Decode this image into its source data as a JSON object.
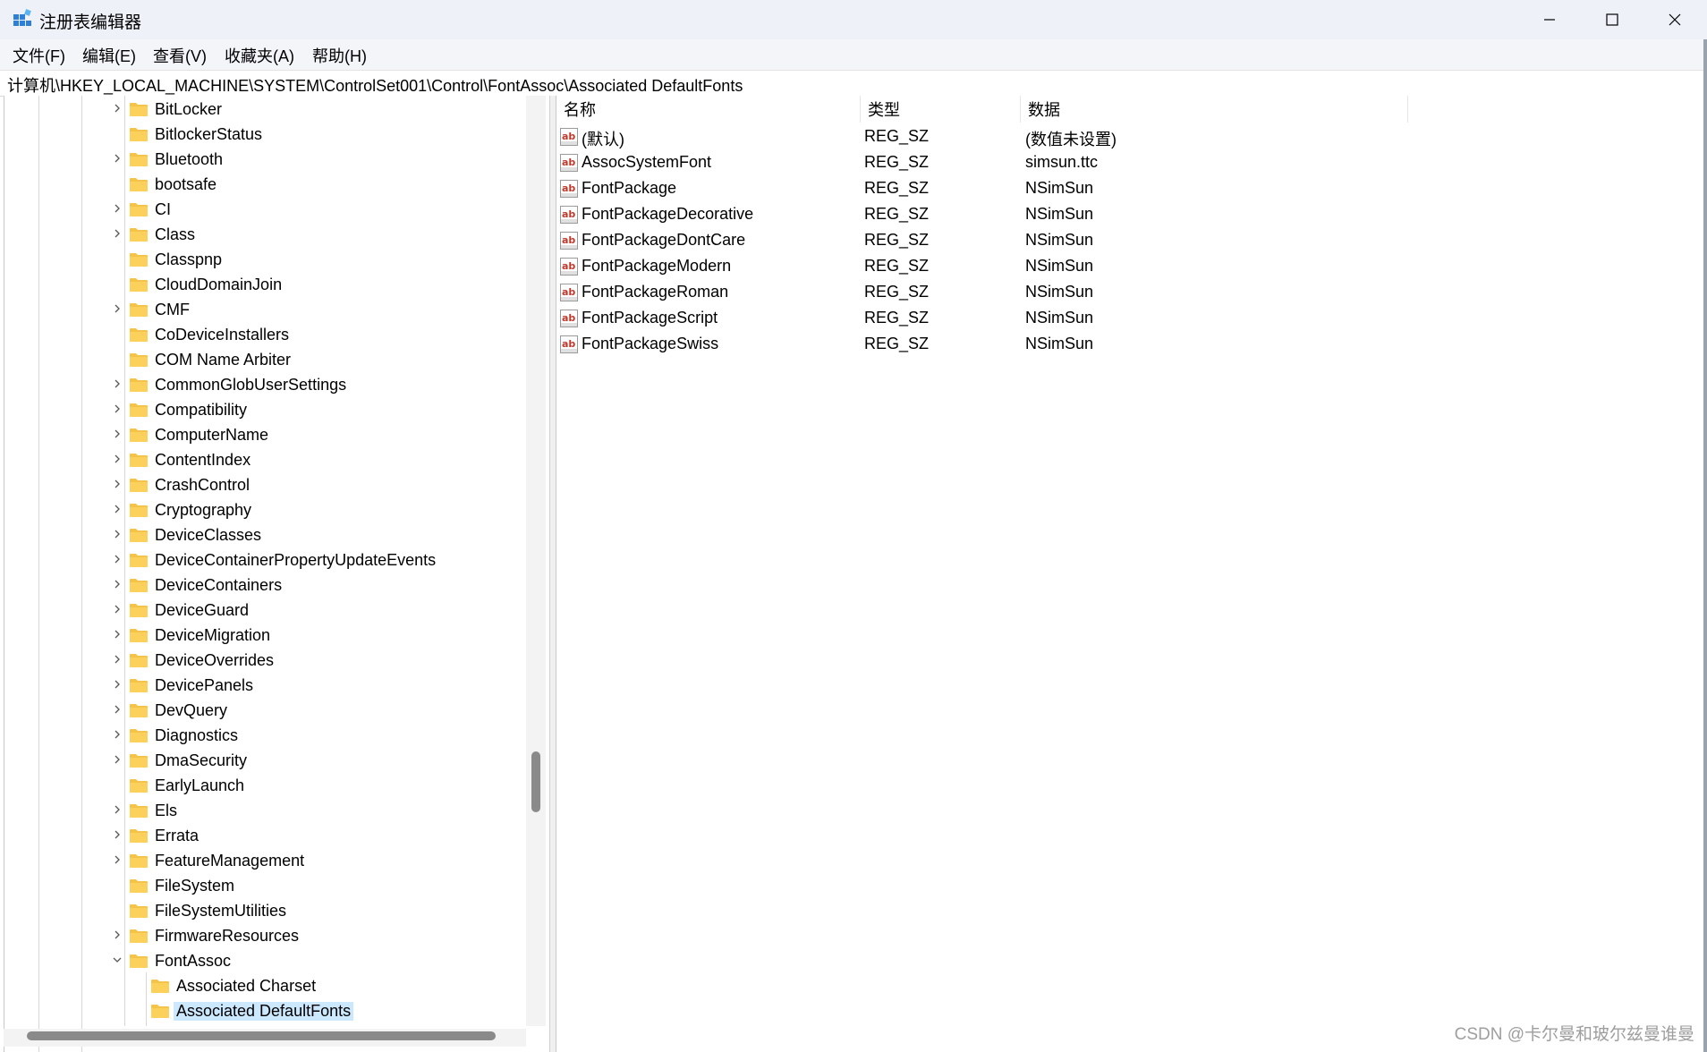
{
  "window": {
    "title": "注册表编辑器",
    "icon": "registry-editor-icon",
    "controls": [
      "minimize-icon",
      "maximize-icon",
      "close-icon"
    ]
  },
  "menu": [
    "文件(F)",
    "编辑(E)",
    "查看(V)",
    "收藏夹(A)",
    "帮助(H)"
  ],
  "address": "计算机\\HKEY_LOCAL_MACHINE\\SYSTEM\\ControlSet001\\Control\\FontAssoc\\Associated DefaultFonts",
  "tree": [
    {
      "label": "BitLocker",
      "expander": "collapsed"
    },
    {
      "label": "BitlockerStatus",
      "expander": "none"
    },
    {
      "label": "Bluetooth",
      "expander": "collapsed"
    },
    {
      "label": "bootsafe",
      "expander": "none"
    },
    {
      "label": "CI",
      "expander": "collapsed"
    },
    {
      "label": "Class",
      "expander": "collapsed"
    },
    {
      "label": "Classpnp",
      "expander": "none"
    },
    {
      "label": "CloudDomainJoin",
      "expander": "none"
    },
    {
      "label": "CMF",
      "expander": "collapsed"
    },
    {
      "label": "CoDeviceInstallers",
      "expander": "none"
    },
    {
      "label": "COM Name Arbiter",
      "expander": "none"
    },
    {
      "label": "CommonGlobUserSettings",
      "expander": "collapsed"
    },
    {
      "label": "Compatibility",
      "expander": "collapsed"
    },
    {
      "label": "ComputerName",
      "expander": "collapsed"
    },
    {
      "label": "ContentIndex",
      "expander": "collapsed"
    },
    {
      "label": "CrashControl",
      "expander": "collapsed"
    },
    {
      "label": "Cryptography",
      "expander": "collapsed"
    },
    {
      "label": "DeviceClasses",
      "expander": "collapsed"
    },
    {
      "label": "DeviceContainerPropertyUpdateEvents",
      "expander": "collapsed"
    },
    {
      "label": "DeviceContainers",
      "expander": "collapsed"
    },
    {
      "label": "DeviceGuard",
      "expander": "collapsed"
    },
    {
      "label": "DeviceMigration",
      "expander": "collapsed"
    },
    {
      "label": "DeviceOverrides",
      "expander": "collapsed"
    },
    {
      "label": "DevicePanels",
      "expander": "collapsed"
    },
    {
      "label": "DevQuery",
      "expander": "collapsed"
    },
    {
      "label": "Diagnostics",
      "expander": "collapsed"
    },
    {
      "label": "DmaSecurity",
      "expander": "collapsed"
    },
    {
      "label": "EarlyLaunch",
      "expander": "none"
    },
    {
      "label": "Els",
      "expander": "collapsed"
    },
    {
      "label": "Errata",
      "expander": "collapsed"
    },
    {
      "label": "FeatureManagement",
      "expander": "collapsed"
    },
    {
      "label": "FileSystem",
      "expander": "none"
    },
    {
      "label": "FileSystemUtilities",
      "expander": "none"
    },
    {
      "label": "FirmwareResources",
      "expander": "collapsed"
    },
    {
      "label": "FontAssoc",
      "expander": "expanded"
    },
    {
      "label": "Associated Charset",
      "expander": "none",
      "child": true
    },
    {
      "label": "Associated DefaultFonts",
      "expander": "none",
      "child": true,
      "selected": true
    }
  ],
  "columns": [
    "名称",
    "类型",
    "数据"
  ],
  "values": [
    {
      "name": "(默认)",
      "type": "REG_SZ",
      "data": "(数值未设置)"
    },
    {
      "name": "AssocSystemFont",
      "type": "REG_SZ",
      "data": "simsun.ttc"
    },
    {
      "name": "FontPackage",
      "type": "REG_SZ",
      "data": "NSimSun"
    },
    {
      "name": "FontPackageDecorative",
      "type": "REG_SZ",
      "data": "NSimSun"
    },
    {
      "name": "FontPackageDontCare",
      "type": "REG_SZ",
      "data": "NSimSun"
    },
    {
      "name": "FontPackageModern",
      "type": "REG_SZ",
      "data": "NSimSun"
    },
    {
      "name": "FontPackageRoman",
      "type": "REG_SZ",
      "data": "NSimSun"
    },
    {
      "name": "FontPackageScript",
      "type": "REG_SZ",
      "data": "NSimSun"
    },
    {
      "name": "FontPackageSwiss",
      "type": "REG_SZ",
      "data": "NSimSun"
    }
  ],
  "value_icon": "string-value-icon",
  "watermark": "CSDN @卡尔曼和玻尔兹曼谁曼",
  "colors": {
    "folder": "#f6c349",
    "selection": "#cce8ff",
    "titlebar": "#eef2f8"
  }
}
